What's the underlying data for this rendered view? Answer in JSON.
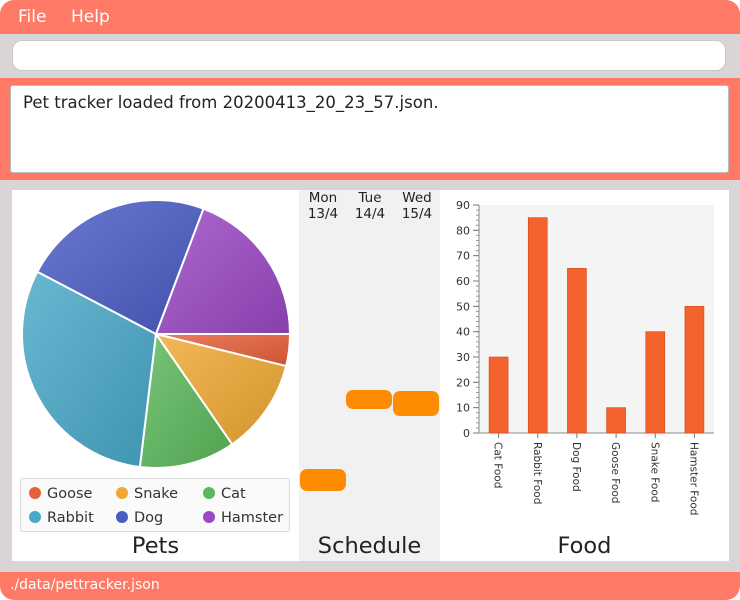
{
  "menu": {
    "file_label": "File",
    "help_label": "Help"
  },
  "command_box": {
    "value": "",
    "placeholder": ""
  },
  "result": {
    "text": "Pet tracker loaded from 20200413_20_23_57.json."
  },
  "pets_panel": {
    "title": "Pets",
    "legend": [
      {
        "label": "Goose",
        "color": "#e8603a"
      },
      {
        "label": "Snake",
        "color": "#f0a832"
      },
      {
        "label": "Cat",
        "color": "#5cb85c"
      },
      {
        "label": "Rabbit",
        "color": "#48a8c8"
      },
      {
        "label": "Dog",
        "color": "#4a5bc4"
      },
      {
        "label": "Hamster",
        "color": "#9b48c4"
      }
    ]
  },
  "schedule_panel": {
    "title": "Schedule",
    "days": [
      {
        "day": "Mon",
        "date": "13/4"
      },
      {
        "day": "Tue",
        "date": "14/4"
      },
      {
        "day": "Wed",
        "date": "15/4"
      }
    ],
    "event_color": "#ff8b00"
  },
  "food_panel": {
    "title": "Food"
  },
  "status": {
    "path": "./data/pettracker.json"
  },
  "chart_data": [
    {
      "type": "pie",
      "categories": [
        "Goose",
        "Snake",
        "Cat",
        "Rabbit",
        "Dog",
        "Hamster"
      ],
      "values": [
        1,
        3,
        3,
        8,
        6,
        5
      ],
      "colors": [
        "#e8603a",
        "#f0a832",
        "#5cb85c",
        "#48a8c8",
        "#4a5bc4",
        "#9b48c4"
      ],
      "legend": "bottom"
    },
    {
      "type": "bar",
      "categories": [
        "Cat Food",
        "Rabbit Food",
        "Dog Food",
        "Goose Food",
        "Snake Food",
        "Hamster Food"
      ],
      "values": [
        30,
        85,
        65,
        10,
        40,
        50
      ],
      "ylim": [
        0,
        90
      ],
      "yticks": [
        0,
        10,
        20,
        30,
        40,
        50,
        60,
        70,
        80,
        90
      ],
      "color": "#f4622e",
      "grid": false
    }
  ]
}
